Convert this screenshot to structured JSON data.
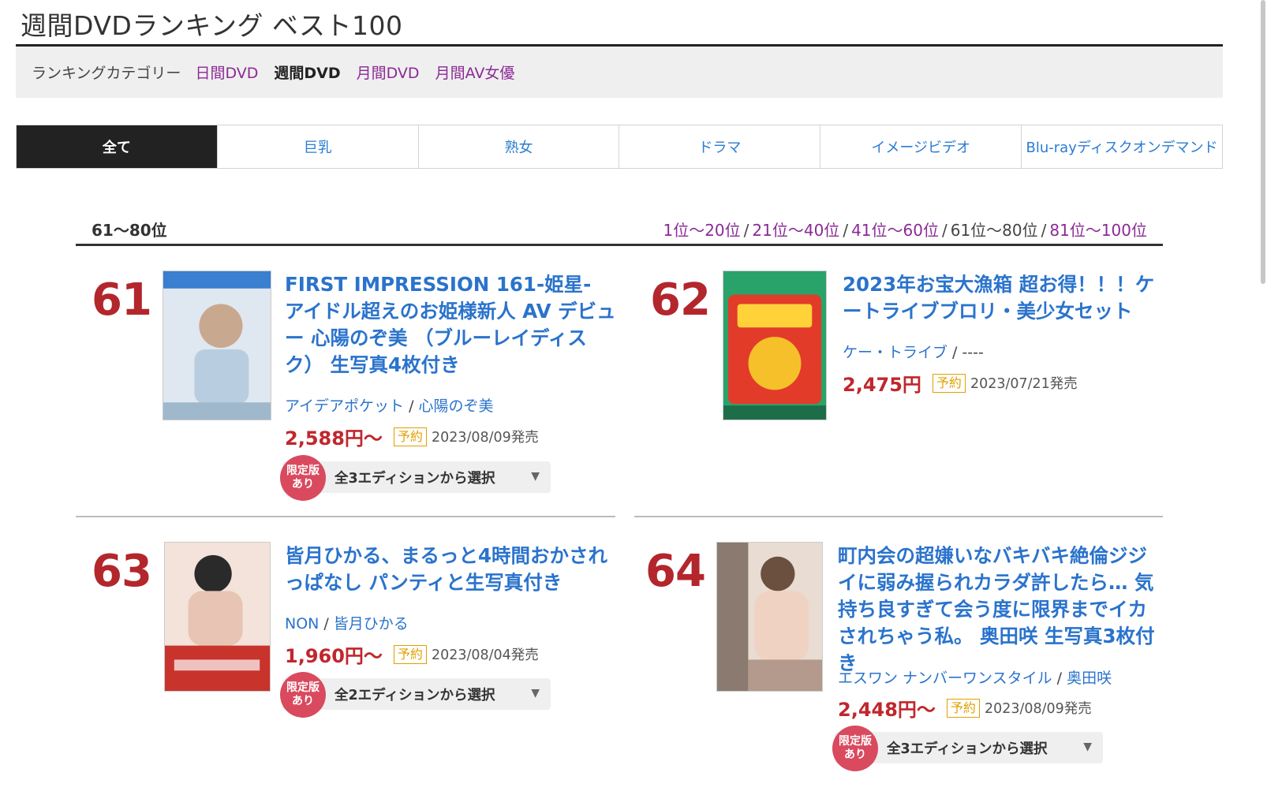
{
  "page": {
    "title": "週間DVDランキング ベスト100"
  },
  "categories": {
    "label": "ランキングカテゴリー",
    "items": [
      {
        "label": "日間DVD",
        "active": false
      },
      {
        "label": "週間DVD",
        "active": true
      },
      {
        "label": "月間DVD",
        "active": false
      },
      {
        "label": "月間AV女優",
        "active": false
      }
    ]
  },
  "genre_tabs": [
    {
      "label": "全て",
      "active": true
    },
    {
      "label": "巨乳",
      "active": false
    },
    {
      "label": "熟女",
      "active": false
    },
    {
      "label": "ドラマ",
      "active": false
    },
    {
      "label": "イメージビデオ",
      "active": false
    },
    {
      "label": "Blu-rayディスクオンデマンド",
      "active": false
    }
  ],
  "range": {
    "current": "61〜80位",
    "nav": [
      {
        "label": "1位〜20位",
        "current": false
      },
      {
        "label": "21位〜40位",
        "current": false
      },
      {
        "label": "41位〜60位",
        "current": false
      },
      {
        "label": "61位〜80位",
        "current": true
      },
      {
        "label": "81位〜100位",
        "current": false
      }
    ],
    "separator": "/"
  },
  "items": [
    {
      "rank": "61",
      "title": "FIRST IMPRESSION 161-姫星- アイドル超えのお姫様新人 AV デビュー 心陽のぞ美 （ブルーレイディスク） 生写真4枚付き",
      "maker": "アイデアポケット",
      "actress": "心陽のぞ美",
      "price": "2,588円〜",
      "badge": "予約",
      "release": "2023/08/09発売",
      "limited": [
        "限定版",
        "あり"
      ],
      "edition": "全3エディションから選択",
      "cover_colors": [
        "#3a7fd0",
        "#dfe8f0"
      ]
    },
    {
      "rank": "62",
      "title": "2023年お宝大漁箱 超お得！！！ケートライブブロリ・美少女セット",
      "maker": "ケー・トライブ",
      "actress": "----",
      "price": "2,475円",
      "badge": "予約",
      "release": "2023/07/21発売",
      "cover_colors": [
        "#2aa36a",
        "#e23b2a"
      ]
    },
    {
      "rank": "63",
      "title": "皆月ひかる、まるっと4時間おかされっぱなし パンティと生写真付き",
      "maker": "NON",
      "actress": "皆月ひかる",
      "price": "1,960円〜",
      "badge": "予約",
      "release": "2023/08/04発売",
      "limited": [
        "限定版",
        "あり"
      ],
      "edition": "全2エディションから選択",
      "cover_colors": [
        "#c8342c",
        "#f3e3da"
      ]
    },
    {
      "rank": "64",
      "title": "町内会の超嫌いなバキバキ絶倫ジジイに弱み握られカラダ許したら… 気持ち良すぎて会う度に限界までイカされちゃう私。 奥田咲 生写真3枚付き",
      "maker": "エスワン ナンバーワンスタイル",
      "actress": "奥田咲",
      "price": "2,448円〜",
      "badge": "予約",
      "release": "2023/08/09発売",
      "limited": [
        "限定版",
        "あり"
      ],
      "edition": "全3エディションから選択",
      "cover_colors": [
        "#8a7a70",
        "#e9dcd2"
      ]
    }
  ]
}
